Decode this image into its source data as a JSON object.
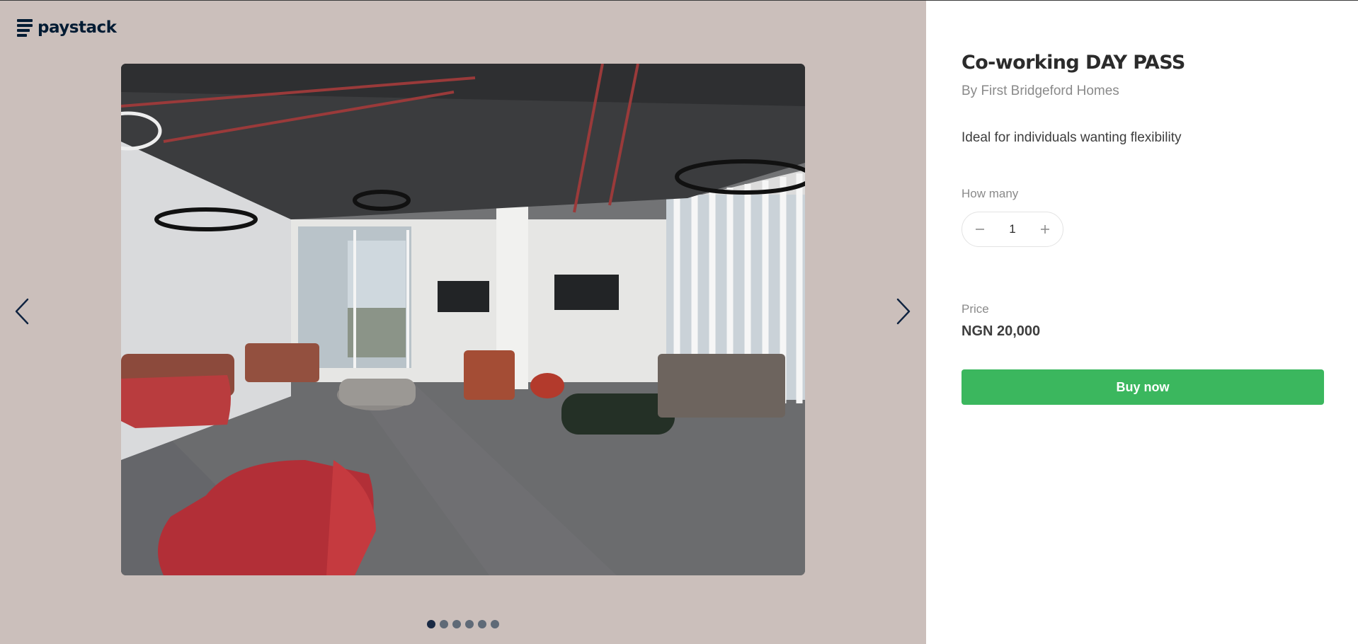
{
  "brand": {
    "name": "paystack",
    "logo_icon": "paystack-stacked-bars-icon",
    "color": "#011b33"
  },
  "gallery": {
    "background": "#cbbfbb",
    "image_alt": "Co-working lounge with red and brown sofas",
    "prev_icon": "chevron-left-icon",
    "next_icon": "chevron-right-icon",
    "slide_count": 6,
    "active_slide": 1
  },
  "product": {
    "title": "Co-working DAY PASS",
    "seller": "By First Bridgeford Homes",
    "description": "Ideal for individuals wanting flexibility"
  },
  "quantity": {
    "label": "How many",
    "value": "1",
    "decrement_icon": "minus-icon",
    "increment_icon": "plus-icon"
  },
  "price": {
    "label": "Price",
    "value": "NGN 20,000"
  },
  "actions": {
    "buy_label": "Buy now",
    "buy_color": "#3bb75e"
  }
}
